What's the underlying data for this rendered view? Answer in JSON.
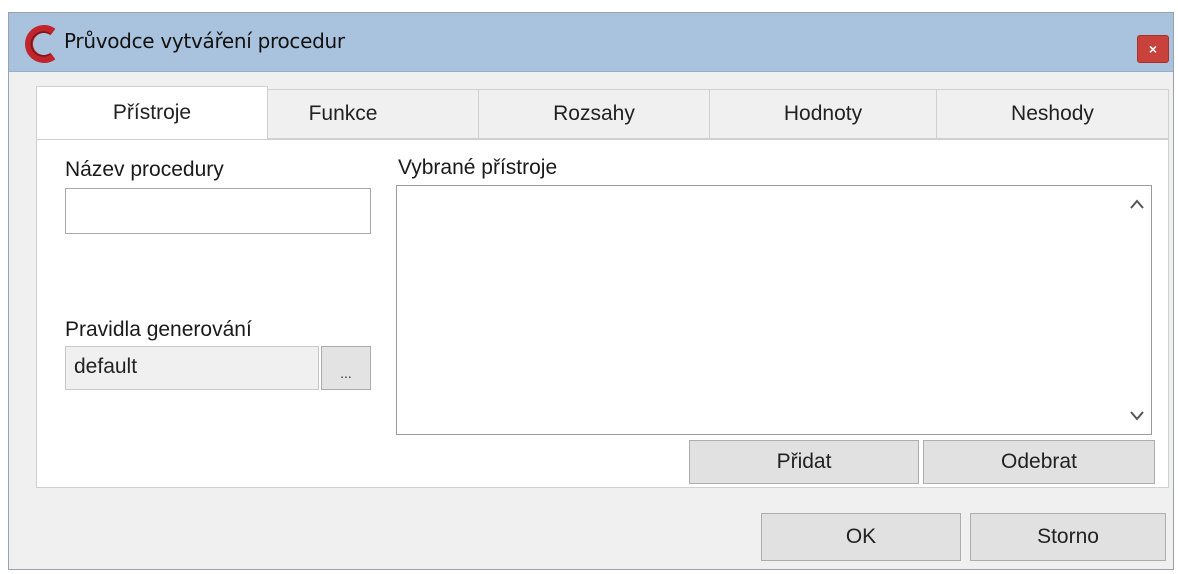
{
  "window": {
    "title": "Průvodce vytváření procedur",
    "close_label": "×",
    "app_icon": "c-logo-icon",
    "accent_color": "#c8413b",
    "titlebar_color": "#a9c3de"
  },
  "tabs": [
    {
      "label": "Přístroje",
      "active": true
    },
    {
      "label": "Funkce",
      "active": false
    },
    {
      "label": "Rozsahy",
      "active": false
    },
    {
      "label": "Hodnoty",
      "active": false
    },
    {
      "label": "Neshody",
      "active": false
    }
  ],
  "form": {
    "procedure_name_label": "Název procedury",
    "procedure_name_value": "",
    "generation_rules_label": "Pravidla generování",
    "generation_rules_value": "default",
    "browse_label": "...",
    "selected_instruments_label": "Vybrané přístroje",
    "selected_instruments_items": [],
    "add_label": "Přidat",
    "remove_label": "Odebrat"
  },
  "footer": {
    "ok_label": "OK",
    "cancel_label": "Storno"
  }
}
